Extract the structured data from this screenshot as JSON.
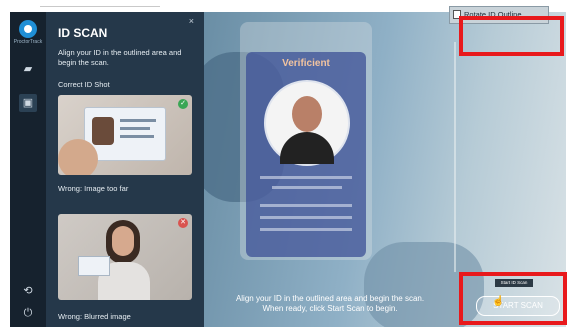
{
  "app": {
    "brand": "ProctorTrack"
  },
  "panel": {
    "title": "ID SCAN",
    "close": "×",
    "instruction": "Align your ID in the outlined area and begin the scan.",
    "correct_label": "Correct ID Shot",
    "wrong1_label": "Wrong: Image too far",
    "wrong2_label": "Wrong: Blurred image",
    "ok_mark": "✓",
    "bad_mark": "✕"
  },
  "camera": {
    "card_header": "Verificient",
    "message_line1": "Align your ID in the outlined area and begin the scan.",
    "message_line2": "When ready, click Start Scan to begin."
  },
  "toolbar": {
    "rotate_label": "Rotate ID Outline",
    "start_tooltip": "Start ID Scan",
    "start_label": "START SCAN"
  },
  "colors": {
    "highlight": "#e8191c",
    "panel": "#25384a",
    "rail": "#16222e"
  },
  "icons": [
    "logo-icon",
    "chat-icon",
    "id-card-icon",
    "settings-icon",
    "power-icon",
    "close-icon",
    "check-icon",
    "error-icon",
    "rotate-icon",
    "cursor-icon"
  ]
}
